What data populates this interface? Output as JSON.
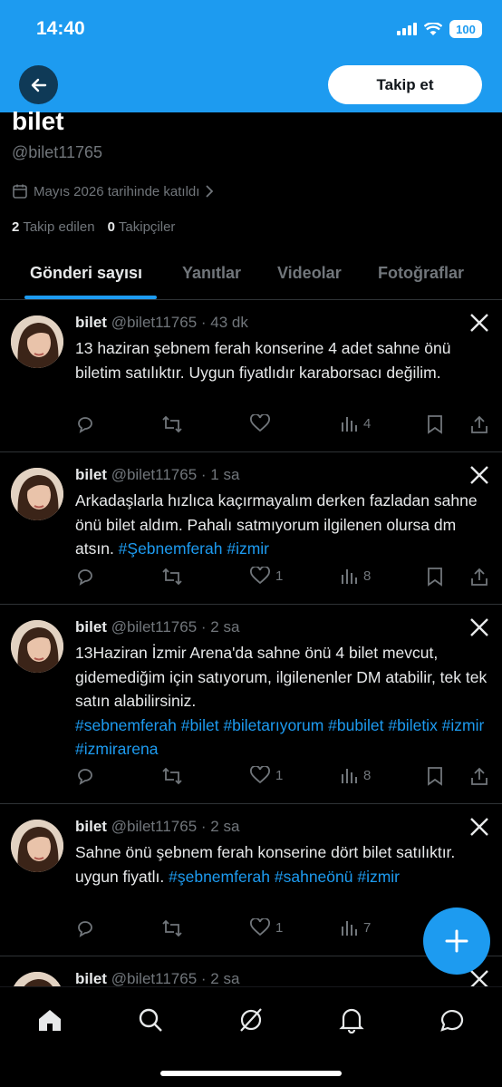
{
  "status_bar": {
    "time": "14:40",
    "battery": "100"
  },
  "header": {
    "follow_label": "Takip et"
  },
  "profile": {
    "name": "bilet",
    "handle": "@bilet11765",
    "joined": "Mayıs 2026 tarihinde katıldı",
    "following_count": "2",
    "following_label": "Takip edilen",
    "followers_count": "0",
    "followers_label": "Takipçiler"
  },
  "tabs": [
    {
      "label": "Gönderi sayısı",
      "active": true
    },
    {
      "label": "Yanıtlar",
      "active": false
    },
    {
      "label": "Videolar",
      "active": false
    },
    {
      "label": "Fotoğraflar",
      "active": false
    }
  ],
  "posts": [
    {
      "name": "bilet",
      "handle": "@bilet11765",
      "time": "· 43 dk",
      "text": "13 haziran şebnem ferah konserine 4 adet sahne önü biletim satılıktır. Uygun fiyatlıdır karaborsacı değilim.",
      "hashtags": "",
      "likes": "",
      "views": "4"
    },
    {
      "name": "bilet",
      "handle": "@bilet11765",
      "time": "· 1 sa",
      "text": "Arkadaşlarla hızlıca kaçırmayalım derken fazladan sahne önü bilet aldım. Pahalı satmıyorum ilgilenen olursa dm atsın. ",
      "hashtags": " #Şebnemferah #izmir",
      "likes": "1",
      "views": "8"
    },
    {
      "name": "bilet",
      "handle": "@bilet11765",
      "time": "· 2 sa",
      "text": "13Haziran İzmir Arena'da sahne önü 4 bilet mevcut, gidemediğim için satıyorum, ilgilenenler DM atabilir, tek tek satın alabilirsiniz.",
      "hashtags": "#sebnemferah #bilet #biletarıyorum #bubilet #biletix #izmir #izmirarena",
      "likes": "1",
      "views": "8"
    },
    {
      "name": "bilet",
      "handle": "@bilet11765",
      "time": "· 2 sa",
      "text": "Sahne önü şebnem ferah konserine dört bilet satılıktır. uygun fiyatlı. ",
      "hashtags": "#şebnemferah #sahneönü #izmir",
      "likes": "1",
      "views": "7"
    },
    {
      "name": "bilet",
      "handle": "@bilet11765",
      "time": "· 2 sa",
      "text": "",
      "hashtags": "",
      "likes": "",
      "views": ""
    }
  ],
  "colors": {
    "accent": "#1d9bf0",
    "background": "#000000",
    "muted": "#71767b"
  },
  "icons": [
    "back-arrow-icon",
    "calendar-icon",
    "chevron-right-icon",
    "x-logo-icon",
    "reply-icon",
    "repost-icon",
    "like-icon",
    "views-icon",
    "bookmark-icon",
    "share-icon",
    "compose-plus-icon",
    "home-icon",
    "search-icon",
    "grok-icon",
    "notifications-icon",
    "messages-icon"
  ]
}
